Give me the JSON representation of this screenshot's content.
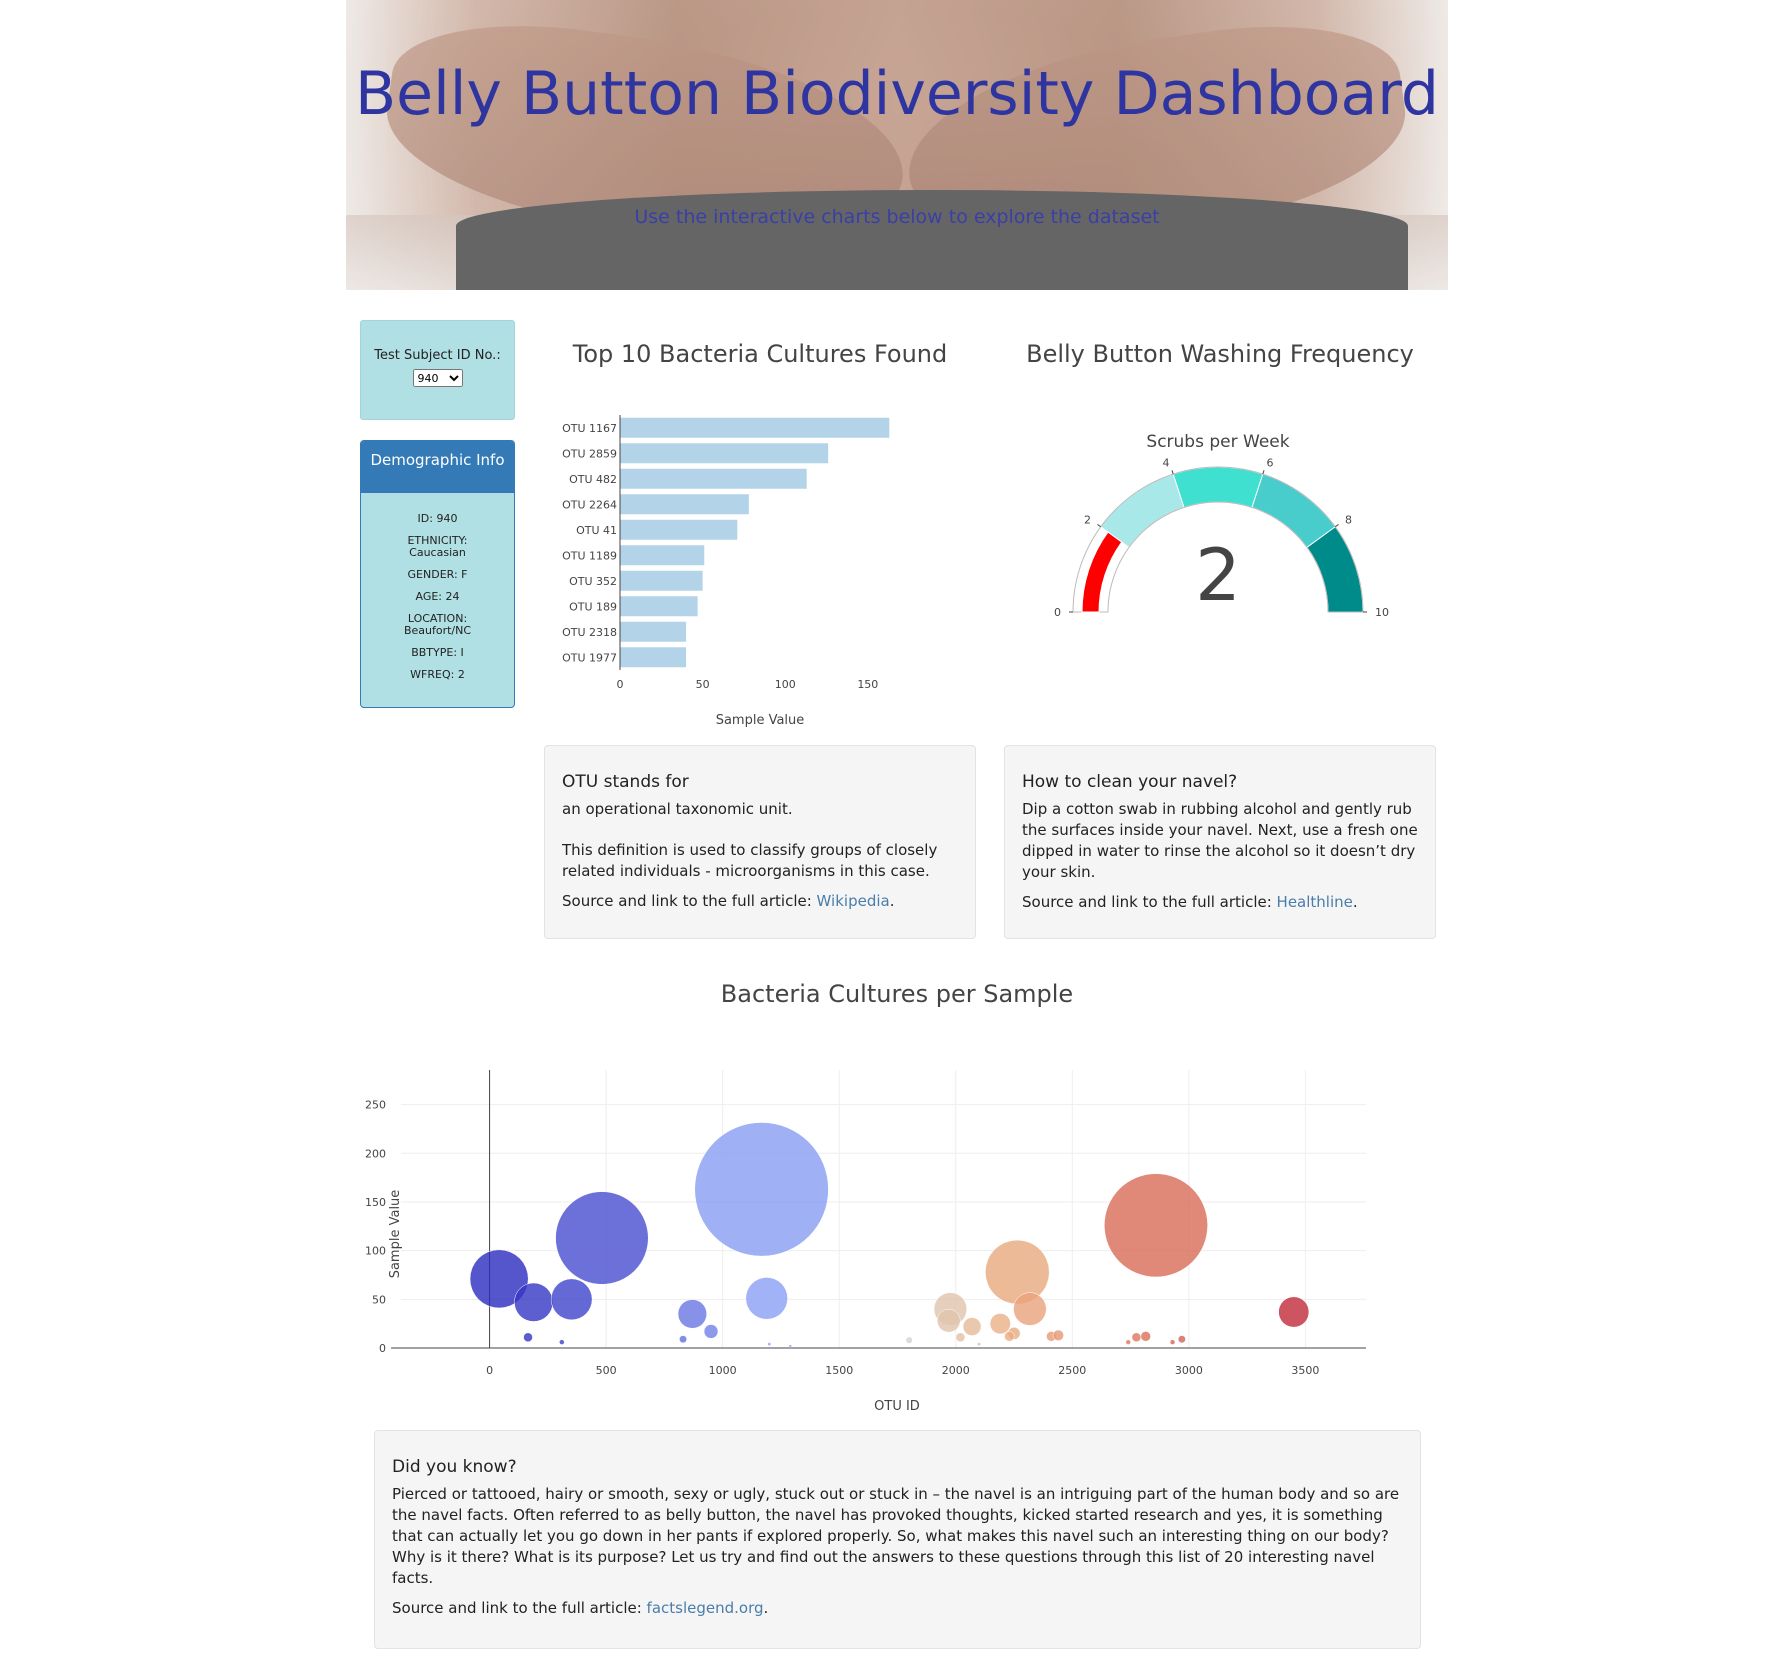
{
  "header": {
    "title": "Belly Button Biodiversity Dashboard",
    "subtitle": "Use the interactive charts below to explore the dataset"
  },
  "selector": {
    "label": "Test Subject ID No.:",
    "selected": "940"
  },
  "demographics": {
    "heading": "Demographic Info",
    "rows": [
      "ID: 940",
      "ETHNICITY: Caucasian",
      "GENDER: F",
      "AGE: 24",
      "LOCATION: Beaufort/NC",
      "BBTYPE: I",
      "WFREQ: 2"
    ]
  },
  "bar_chart": {
    "title": "Top 10 Bacteria Cultures Found",
    "xlabel": "Sample Value"
  },
  "gauge": {
    "title": "Belly Button Washing Frequency",
    "subtitle": "Scrubs per Week",
    "value": "2"
  },
  "bubble_chart": {
    "title": "Bacteria Cultures per Sample",
    "xlabel": "OTU ID",
    "ylabel": "Sample Value"
  },
  "info_otu": {
    "heading": "OTU stands for",
    "p1": "an operational taxonomic unit.",
    "p2": "This definition is used to classify groups of closely related individuals - microorganisms in this case.",
    "source_prefix": "Source and link to the full article: ",
    "link": "Wikipedia",
    "suffix": "."
  },
  "info_clean": {
    "heading": "How to clean your navel?",
    "p1": "Dip a cotton swab in rubbing alcohol and gently rub the surfaces inside your navel. Next, use a fresh one dipped in water to rinse the alcohol so it doesn’t dry your skin.",
    "source_prefix": "Source and link to the full article: ",
    "link": "Healthline",
    "suffix": "."
  },
  "info_facts": {
    "heading": "Did you know?",
    "p1": "Pierced or tattooed, hairy or smooth, sexy or ugly, stuck out or stuck in – the navel is an intriguing part of the human body and so are the navel facts. Often referred to as belly button, the navel has provoked thoughts, kicked started research and yes, it is something that can actually let you go down in her pants if explored properly. So, what makes this navel such an interesting thing on our body? Why is it there? What is its purpose? Let us try and find out the answers to these questions through this list of 20 interesting navel facts.",
    "source_prefix": "Source and link to the full article: ",
    "link": "factslegend.org",
    "suffix": "."
  },
  "chart_data": [
    {
      "type": "bar",
      "title": "Top 10 Bacteria Cultures Found",
      "xlabel": "Sample Value",
      "categories": [
        "OTU 1167",
        "OTU 2859",
        "OTU 482",
        "OTU 2264",
        "OTU 41",
        "OTU 1189",
        "OTU 352",
        "OTU 189",
        "OTU 2318",
        "OTU 1977"
      ],
      "values": [
        163,
        126,
        113,
        78,
        71,
        51,
        50,
        47,
        40,
        40
      ],
      "xlim": [
        0,
        165
      ],
      "xticks": [
        0,
        50,
        100,
        150
      ],
      "color": "#b3d4e8"
    },
    {
      "type": "gauge",
      "title": "Belly Button Washing Frequency",
      "subtitle": "Scrubs per Week",
      "value": 2,
      "range": [
        0,
        10
      ],
      "ticks": [
        0,
        2,
        4,
        6,
        8,
        10
      ],
      "steps": [
        {
          "range": [
            0,
            2
          ],
          "color": "#ffffff"
        },
        {
          "range": [
            2,
            4
          ],
          "color": "#a8e8e8"
        },
        {
          "range": [
            4,
            6
          ],
          "color": "#40e0d0"
        },
        {
          "range": [
            6,
            8
          ],
          "color": "#48cccc"
        },
        {
          "range": [
            8,
            10
          ],
          "color": "#008b8b"
        }
      ],
      "bar_color": "#ff0000"
    },
    {
      "type": "scatter",
      "title": "Bacteria Cultures per Sample",
      "xlabel": "OTU ID",
      "ylabel": "Sample Value",
      "xlim": [
        -380,
        3760
      ],
      "ylim": [
        0,
        265
      ],
      "xticks": [
        0,
        500,
        1000,
        1500,
        2000,
        2500,
        3000,
        3500
      ],
      "yticks": [
        0,
        50,
        100,
        150,
        200,
        250
      ],
      "points": [
        {
          "x": 41,
          "y": 71
        },
        {
          "x": 189,
          "y": 47
        },
        {
          "x": 352,
          "y": 50
        },
        {
          "x": 482,
          "y": 113
        },
        {
          "x": 1167,
          "y": 163
        },
        {
          "x": 1189,
          "y": 51
        },
        {
          "x": 870,
          "y": 35
        },
        {
          "x": 950,
          "y": 17
        },
        {
          "x": 1977,
          "y": 40
        },
        {
          "x": 1970,
          "y": 28
        },
        {
          "x": 2070,
          "y": 22
        },
        {
          "x": 2264,
          "y": 78
        },
        {
          "x": 2318,
          "y": 40
        },
        {
          "x": 2191,
          "y": 25
        },
        {
          "x": 2859,
          "y": 126
        },
        {
          "x": 3450,
          "y": 37
        },
        {
          "x": 165,
          "y": 11
        },
        {
          "x": 310,
          "y": 6
        },
        {
          "x": 830,
          "y": 9
        },
        {
          "x": 1800,
          "y": 8
        },
        {
          "x": 2020,
          "y": 11
        },
        {
          "x": 2250,
          "y": 15
        },
        {
          "x": 2230,
          "y": 12
        },
        {
          "x": 2410,
          "y": 12
        },
        {
          "x": 2440,
          "y": 13
        },
        {
          "x": 2775,
          "y": 11
        },
        {
          "x": 2815,
          "y": 12
        },
        {
          "x": 2970,
          "y": 9
        },
        {
          "x": 2930,
          "y": 6
        },
        {
          "x": 2740,
          "y": 6
        },
        {
          "x": 1200,
          "y": 4
        },
        {
          "x": 1290,
          "y": 2
        },
        {
          "x": 2100,
          "y": 4
        }
      ]
    }
  ]
}
